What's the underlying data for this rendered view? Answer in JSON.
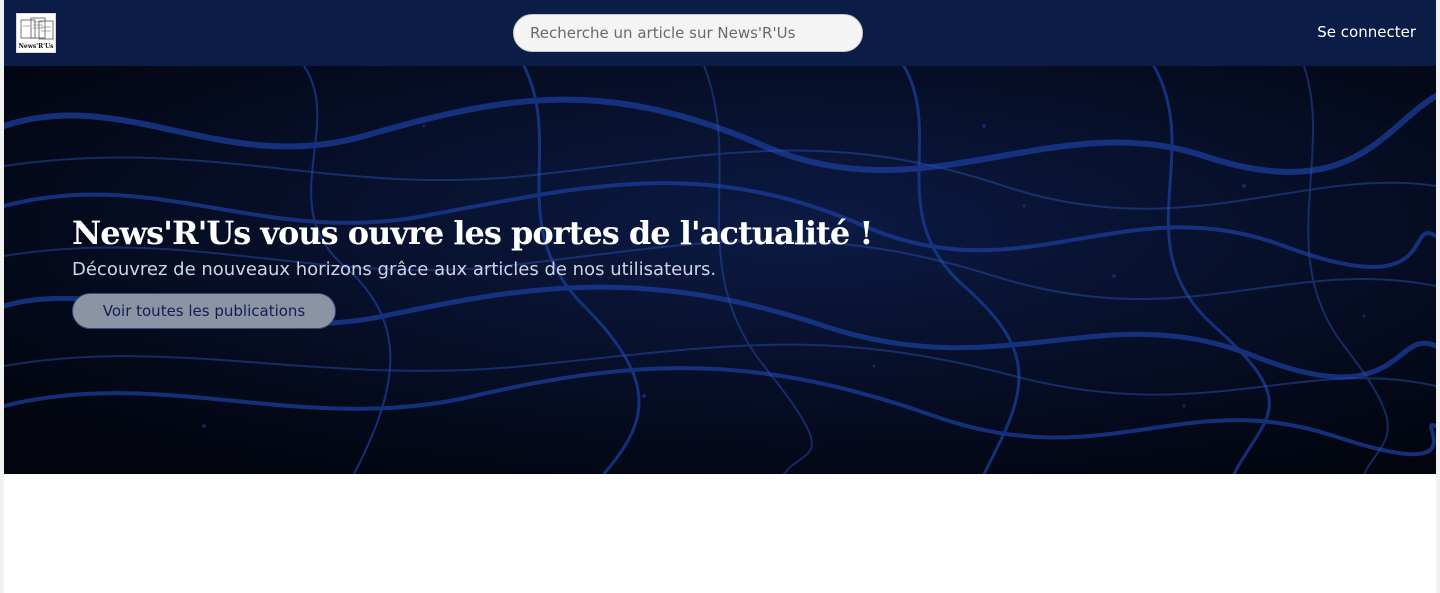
{
  "header": {
    "logo_text": "News'R'Us",
    "search_placeholder": "Recherche un article sur News'R'Us",
    "login_label": "Se connecter"
  },
  "hero": {
    "title": "News'R'Us vous ouvre les portes de l'actualité !",
    "subtitle": "Découvrez de nouveaux horizons grâce aux articles de nos utilisateurs.",
    "button_label": "Voir toutes les publications"
  },
  "colors": {
    "navbar_bg": "#0b1c47",
    "hero_bg": "#040a1c",
    "hero_pattern": "#1a3d9a",
    "button_bg": "#8c93a3",
    "button_text": "#0f214e"
  },
  "icons": {
    "logo": "newspaper-stack-icon"
  }
}
